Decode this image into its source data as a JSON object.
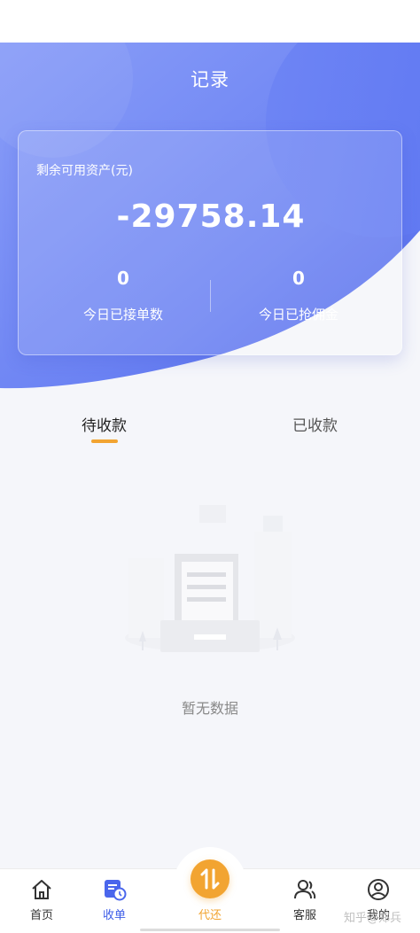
{
  "header": {
    "title": "记录"
  },
  "asset_card": {
    "label": "剩余可用资产(元)",
    "value": "-29758.14",
    "stats": [
      {
        "value": "0",
        "label": "今日已接单数"
      },
      {
        "value": "0",
        "label": "今日已抢佣金"
      }
    ]
  },
  "tabs": [
    {
      "label": "待收款",
      "active": true
    },
    {
      "label": "已收款",
      "active": false
    }
  ],
  "empty_state": {
    "text": "暂无数据",
    "icon": "empty-document-icon"
  },
  "tabbar": {
    "items": [
      {
        "label": "首页",
        "icon": "home-icon"
      },
      {
        "label": "收单",
        "icon": "orders-clock-icon",
        "active": true
      },
      {
        "label": "代还",
        "icon": "swap-arrows-icon"
      },
      {
        "label": "客服",
        "icon": "customer-service-icon"
      },
      {
        "label": "我的",
        "icon": "user-icon"
      }
    ]
  },
  "watermark": "知乎@郑兵",
  "colors": {
    "primary": "#5b74f0",
    "accent": "#f2a431",
    "active_tab": "#3d5ce8"
  }
}
